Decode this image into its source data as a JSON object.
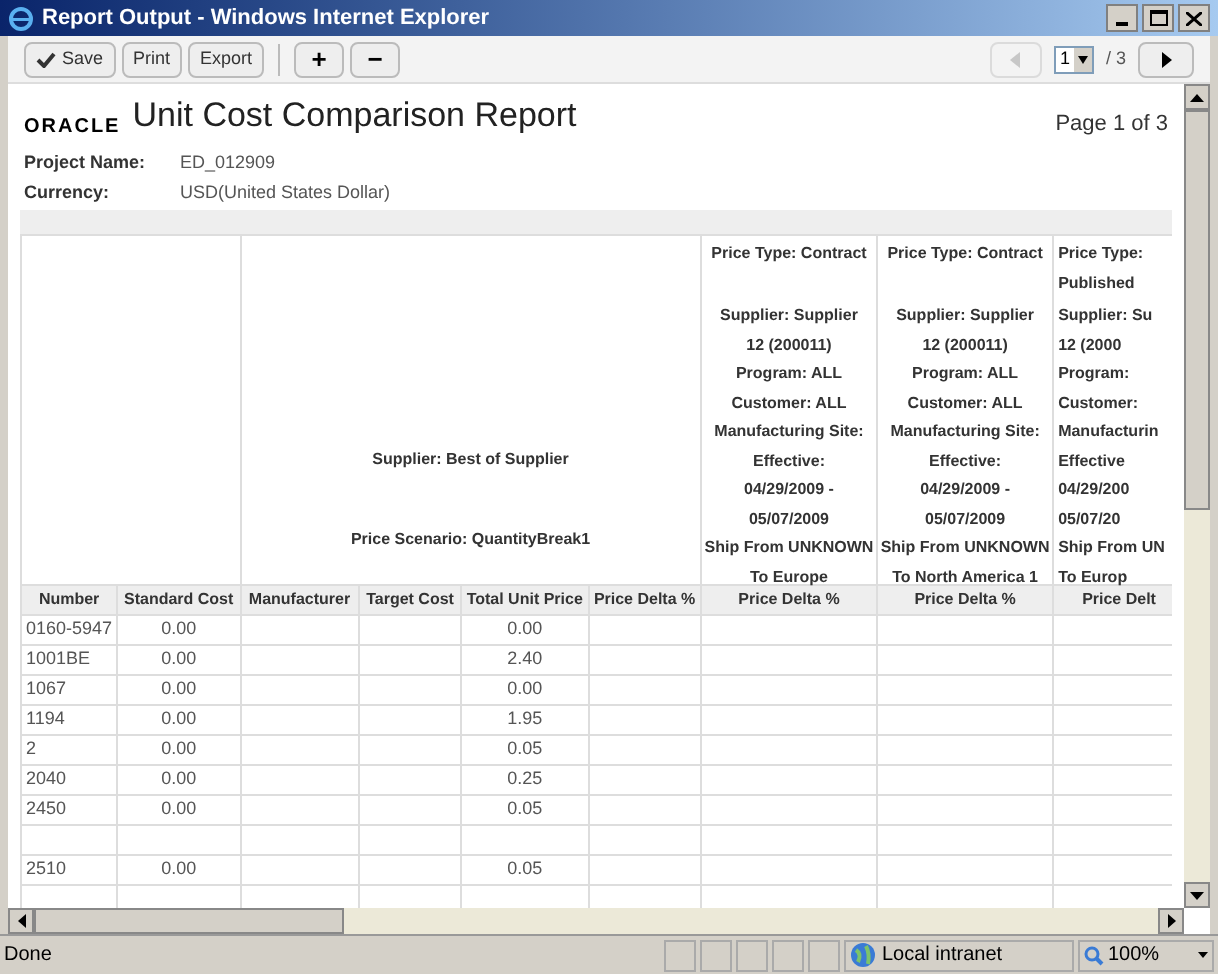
{
  "window": {
    "title": "Report Output - Windows Internet Explorer"
  },
  "toolbar": {
    "buttons": [
      {
        "label": "Save",
        "kind": "check"
      },
      {
        "label": "Print",
        "kind": "text"
      },
      {
        "label": "Export",
        "kind": "text"
      }
    ],
    "zoom_buttons": [
      "+",
      "−"
    ],
    "page_select": "1",
    "page_total": "/ 3",
    "prev_disabled": true
  },
  "report": {
    "logo": "ORACLE",
    "title": "Unit Cost Comparison Report",
    "page": "Page 1 of 3",
    "fields": [
      {
        "label": "Project Name:",
        "value": "ED_012909"
      },
      {
        "label": "Currency:",
        "value": "USD(United States Dollar)"
      }
    ],
    "group_headers": {
      "supplier": "Supplier: Best of Supplier",
      "scenario": "Price Scenario: QuantityBreak1",
      "suppliers": [
        {
          "price_type": [
            "Price Type: Contract"
          ],
          "details": [
            "Supplier: Supplier",
            "12 (200011)",
            "Program: ALL",
            "Customer: ALL",
            "Manufacturing Site:",
            "Effective:",
            "04/29/2009 -",
            "05/07/2009"
          ],
          "ship": [
            "Ship From UNKNOWN",
            "To Europe"
          ]
        },
        {
          "price_type": [
            "Price Type: Contract"
          ],
          "details": [
            "Supplier: Supplier",
            "12 (200011)",
            "Program: ALL",
            "Customer: ALL",
            "Manufacturing Site:",
            "Effective:",
            "04/29/2009 -",
            "05/07/2009"
          ],
          "ship": [
            "Ship From UNKNOWN",
            "To North America 1"
          ]
        },
        {
          "price_type": [
            "Price Type:",
            "Published"
          ],
          "details": [
            "Supplier: Su",
            "12 (2000",
            "Program:",
            "Customer:",
            "Manufacturin",
            "Effective",
            "04/29/200",
            "05/07/20"
          ],
          "ship": [
            "Ship From UN",
            "To Europ"
          ]
        }
      ]
    },
    "columns": [
      "Number",
      "Standard Cost",
      "Manufacturer",
      "Target Cost",
      "Total Unit Price",
      "Price Delta %",
      "Price Delta %",
      "Price Delta %",
      "Price Delt"
    ],
    "rows": [
      {
        "number": "0160-5947",
        "standard_cost": "0.00",
        "total_unit_price": "0.00"
      },
      {
        "number": "1001BE",
        "standard_cost": "0.00",
        "total_unit_price": "2.40"
      },
      {
        "number": "1067",
        "standard_cost": "0.00",
        "total_unit_price": "0.00"
      },
      {
        "number": "1194",
        "standard_cost": "0.00",
        "total_unit_price": "1.95"
      },
      {
        "number": "2",
        "standard_cost": "0.00",
        "total_unit_price": "0.05"
      },
      {
        "number": "2040",
        "standard_cost": "0.00",
        "total_unit_price": "0.25"
      },
      {
        "number": "2450",
        "standard_cost": "0.00",
        "total_unit_price": "0.05"
      },
      {},
      {
        "number": "2510",
        "standard_cost": "0.00",
        "total_unit_price": "0.05"
      }
    ]
  },
  "status_bar": {
    "text": "Done",
    "zone": "Local intranet",
    "zoom": "100%"
  }
}
